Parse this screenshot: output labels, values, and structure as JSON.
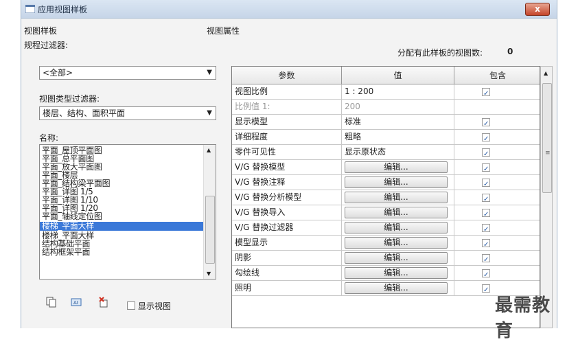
{
  "window": {
    "title": "应用视图样板",
    "close_label": "x"
  },
  "left_panel": {
    "heading": "视图样板",
    "discipline_filter_label": "规程过滤器:",
    "discipline_filter_value": "<全部>",
    "view_type_filter_label": "视图类型过滤器:",
    "view_type_filter_value": "楼层、结构、面积平面",
    "names_label": "名称:",
    "names": [
      "平面_屋顶平面图",
      "平面_总平面图",
      "平面_放大平面图",
      "平面_楼层",
      "平面_结构梁平面图",
      "平面_详图 1/5",
      "平面_详图 1/10",
      "平面_详图 1/20",
      "平面_轴线定位图",
      "楼梯_平面大样",
      "楼梯_平面大样",
      "结构基础平面",
      "结构框架平面"
    ],
    "selected_index": 9,
    "show_views_label": "显示视图",
    "show_views_checked": false
  },
  "right_panel": {
    "heading": "视图属性",
    "assigned_label": "分配有此样板的视图数:",
    "assigned_count": "0",
    "columns": {
      "param": "参数",
      "value": "值",
      "include": "包含"
    },
    "edit_label": "编辑...",
    "rows": [
      {
        "param": "视图比例",
        "value": "1 : 200",
        "button": false,
        "include": true,
        "grey": false
      },
      {
        "param": "比例值 1:",
        "value": "200",
        "button": false,
        "include": null,
        "grey": true
      },
      {
        "param": "显示模型",
        "value": "标准",
        "button": false,
        "include": true,
        "grey": false
      },
      {
        "param": "详细程度",
        "value": "粗略",
        "button": false,
        "include": true,
        "grey": false
      },
      {
        "param": "零件可见性",
        "value": "显示原状态",
        "button": false,
        "include": true,
        "grey": false
      },
      {
        "param": "V/G 替换模型",
        "value": "",
        "button": true,
        "include": true,
        "grey": false
      },
      {
        "param": "V/G 替换注释",
        "value": "",
        "button": true,
        "include": true,
        "grey": false
      },
      {
        "param": "V/G 替换分析模型",
        "value": "",
        "button": true,
        "include": true,
        "grey": false
      },
      {
        "param": "V/G 替换导入",
        "value": "",
        "button": true,
        "include": true,
        "grey": false
      },
      {
        "param": "V/G 替换过滤器",
        "value": "",
        "button": true,
        "include": true,
        "grey": false
      },
      {
        "param": "模型显示",
        "value": "",
        "button": true,
        "include": true,
        "grey": false
      },
      {
        "param": "阴影",
        "value": "",
        "button": true,
        "include": true,
        "grey": false
      },
      {
        "param": "勾绘线",
        "value": "",
        "button": true,
        "include": true,
        "grey": false
      },
      {
        "param": "照明",
        "value": "",
        "button": true,
        "include": true,
        "grey": false
      }
    ]
  },
  "watermark": "最需教育",
  "colors": {
    "selection": "#3a78d8",
    "title_bar": "#c6d5e8",
    "close": "#c4452a"
  }
}
